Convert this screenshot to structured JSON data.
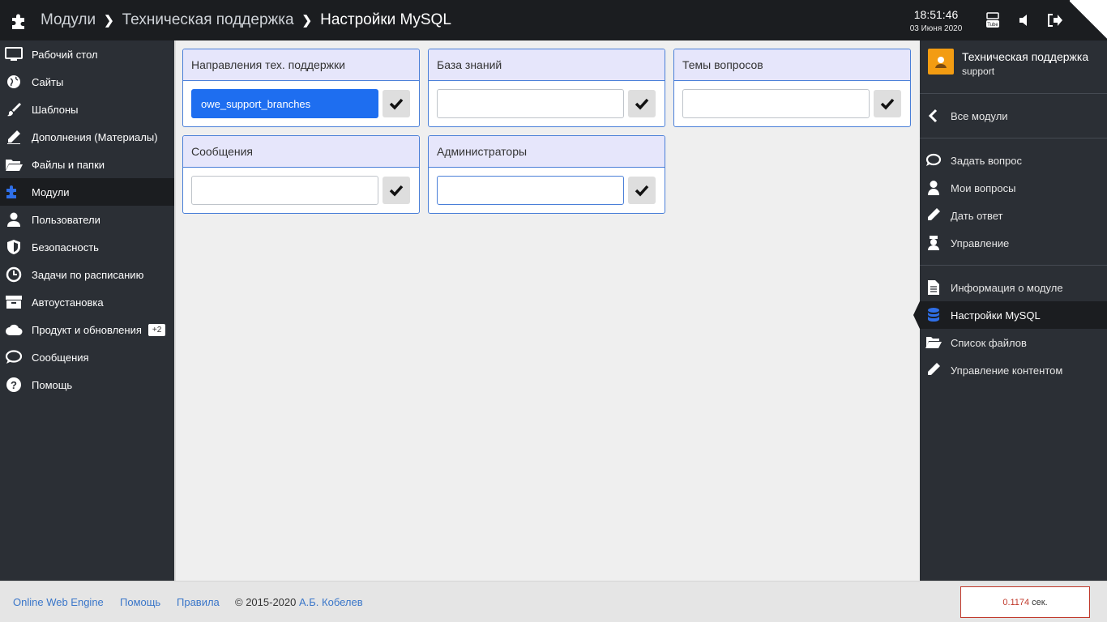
{
  "header": {
    "breadcrumbs": [
      "Модули",
      "Техническая поддержка",
      "Настройки MySQL"
    ],
    "time": "18:51:46",
    "date": "03 Июня 2020",
    "icons": [
      "puzzle-icon",
      "youtube-icon",
      "volume-icon",
      "logout-icon"
    ]
  },
  "left_nav": [
    {
      "label": "Рабочий стол",
      "icon": "monitor-icon"
    },
    {
      "label": "Сайты",
      "icon": "globe-icon"
    },
    {
      "label": "Шаблоны",
      "icon": "brush-icon"
    },
    {
      "label": "Дополнения (Материалы)",
      "icon": "pencil-icon"
    },
    {
      "label": "Файлы и папки",
      "icon": "folder-icon"
    },
    {
      "label": "Модули",
      "icon": "puzzle-icon",
      "active": true
    },
    {
      "label": "Пользователи",
      "icon": "user-icon"
    },
    {
      "label": "Безопасность",
      "icon": "shield-icon"
    },
    {
      "label": "Задачи по расписанию",
      "icon": "clock-icon"
    },
    {
      "label": "Автоустановка",
      "icon": "box-icon"
    },
    {
      "label": "Продукт и обновления",
      "icon": "cloud-icon",
      "badge": "+2"
    },
    {
      "label": "Сообщения",
      "icon": "chat-icon"
    },
    {
      "label": "Помощь",
      "icon": "help-icon"
    }
  ],
  "panels": [
    {
      "title": "Направления тех. поддержки",
      "value": "owe_support_branches"
    },
    {
      "title": "База знаний",
      "value": ""
    },
    {
      "title": "Темы вопросов",
      "value": ""
    },
    {
      "title": "Сообщения",
      "value": ""
    },
    {
      "title": "Администраторы",
      "value": ""
    }
  ],
  "right_panel": {
    "module_title": "Техническая поддержка",
    "module_sub": "support",
    "back": "Все модули",
    "group1": [
      {
        "label": "Задать вопрос",
        "icon": "chat-icon"
      },
      {
        "label": "Мои вопросы",
        "icon": "user-icon"
      },
      {
        "label": "Дать ответ",
        "icon": "pencil-icon"
      },
      {
        "label": "Управление",
        "icon": "admin-icon"
      }
    ],
    "group2": [
      {
        "label": "Информация о модуле",
        "icon": "document-icon"
      },
      {
        "label": "Настройки MySQL",
        "icon": "database-icon",
        "active": true
      },
      {
        "label": "Список файлов",
        "icon": "folder-icon"
      },
      {
        "label": "Управление контентом",
        "icon": "pencil-icon"
      }
    ]
  },
  "footer": {
    "links": [
      "Online Web Engine",
      "Помощь",
      "Правила"
    ],
    "copyright": "© 2015-2020",
    "author": "А.Б. Кобелев",
    "timer_value": "0.1174",
    "timer_unit": "сек."
  },
  "colors": {
    "accent": "#1e6ef0",
    "panel_border": "#4a7fd8",
    "sidebar_bg": "#2b2f35",
    "topbar_bg": "#1b1d20",
    "module_logo": "#f39c12"
  }
}
